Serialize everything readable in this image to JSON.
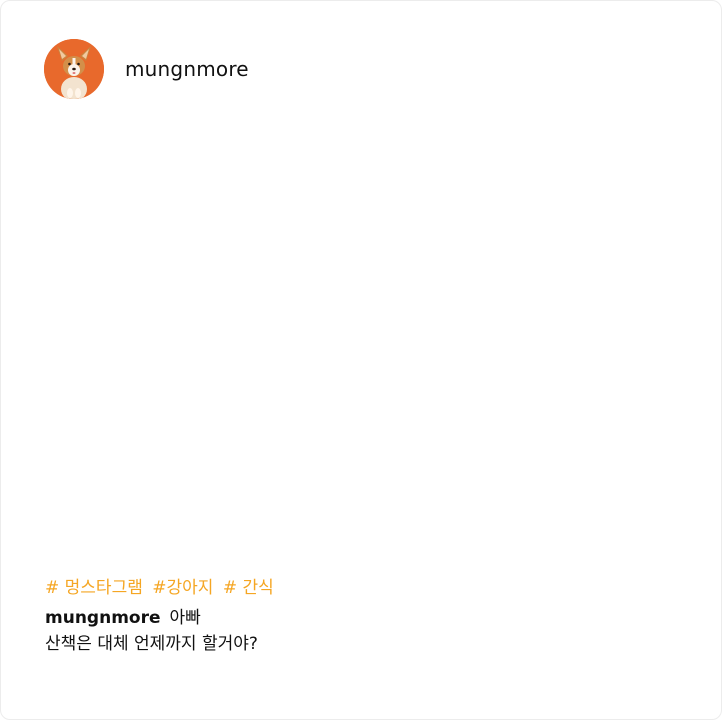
{
  "post": {
    "username": "mungnmore",
    "avatar_icon": "corgi-dog-avatar",
    "avatar_bg": "#e8692c",
    "hashtags": [
      "# 멍스타그램",
      "#강아지",
      "# 간식"
    ],
    "hashtag_color": "#f5a623",
    "caption": {
      "author": "mungnmore",
      "line1": "아빠",
      "line2": "산책은 대체 언제까지 할거야?"
    }
  }
}
